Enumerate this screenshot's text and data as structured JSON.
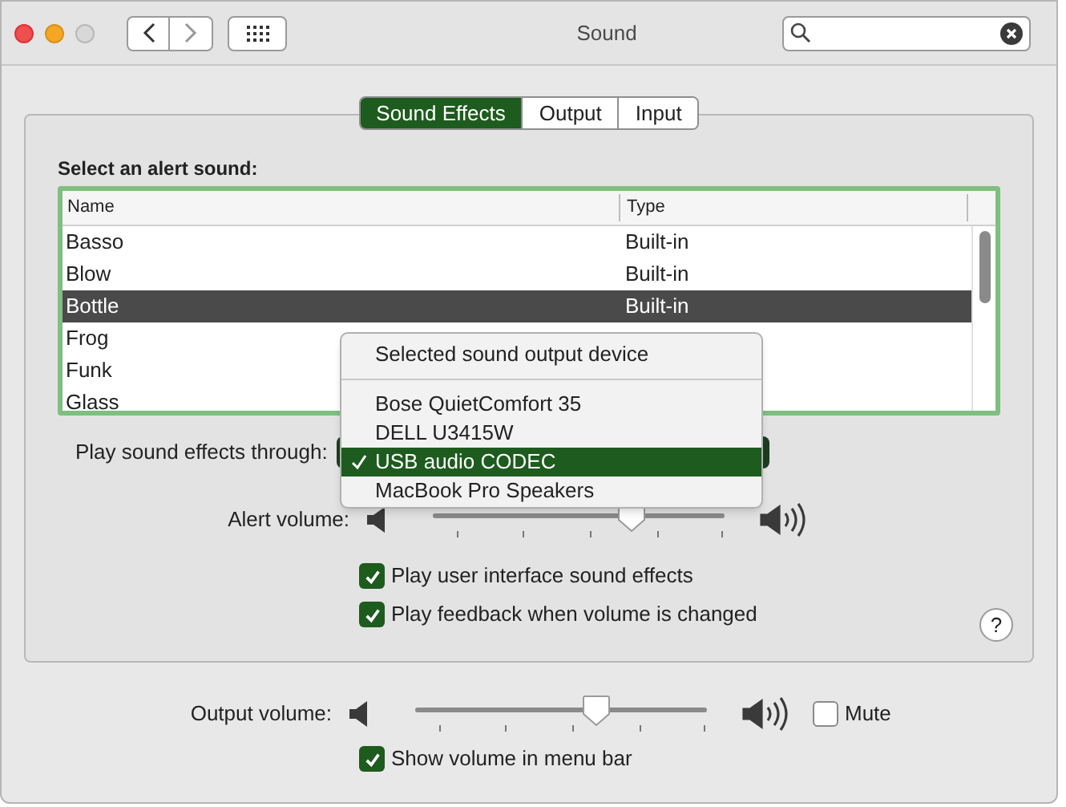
{
  "window": {
    "title": "Sound"
  },
  "tabs": [
    {
      "label": "Sound Effects",
      "selected": true
    },
    {
      "label": "Output",
      "selected": false
    },
    {
      "label": "Input",
      "selected": false
    }
  ],
  "alert_list": {
    "label": "Select an alert sound:",
    "columns": [
      "Name",
      "Type"
    ],
    "rows": [
      {
        "name": "Basso",
        "type": "Built-in",
        "selected": false
      },
      {
        "name": "Blow",
        "type": "Built-in",
        "selected": false
      },
      {
        "name": "Bottle",
        "type": "Built-in",
        "selected": true
      },
      {
        "name": "Frog",
        "selected": false
      },
      {
        "name": "Funk",
        "selected": false
      },
      {
        "name": "Glass",
        "selected": false
      }
    ]
  },
  "play_through": {
    "label": "Play sound effects through:"
  },
  "output_menu": {
    "title": "Selected sound output device",
    "items": [
      {
        "label": "Bose QuietComfort 35",
        "selected": false
      },
      {
        "label": "DELL U3415W",
        "selected": false
      },
      {
        "label": "USB audio CODEC",
        "selected": true
      },
      {
        "label": "MacBook Pro Speakers",
        "selected": false
      }
    ]
  },
  "alert_volume": {
    "label": "Alert volume:",
    "level": 0.68
  },
  "effect_options": [
    {
      "label": "Play user interface sound effects",
      "checked": true
    },
    {
      "label": "Play feedback when volume is changed",
      "checked": true
    }
  ],
  "help": "?",
  "output_volume": {
    "label": "Output volume:",
    "level": 0.62
  },
  "mute": {
    "label": "Mute",
    "checked": false
  },
  "show_volume": {
    "label": "Show volume in menu bar",
    "checked": true
  }
}
